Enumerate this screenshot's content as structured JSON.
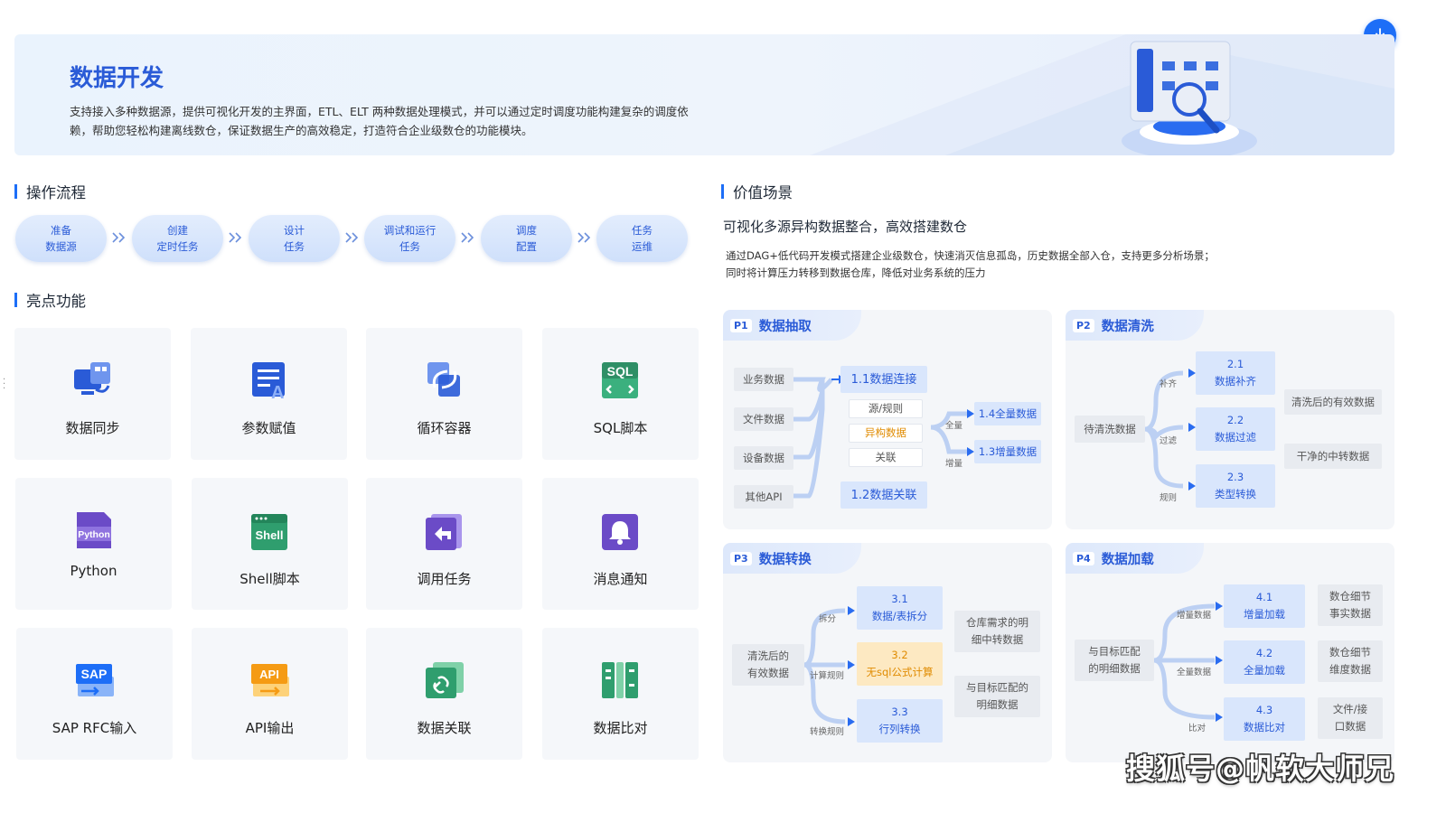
{
  "banner": {
    "title": "数据开发",
    "description": "支持接入多种数据源，提供可视化开发的主界面，ETL、ELT 两种数据处理模式，并可以通过定时调度功能构建复杂的调度依赖，帮助您轻松构建离线数仓，保证数据生产的高效稳定，打造符合企业级数仓的功能模块。"
  },
  "download_icon": "download-icon",
  "process": {
    "heading": "操作流程",
    "steps": [
      "准备\n数据源",
      "创建\n定时任务",
      "设计\n任务",
      "调试和运行\n任务",
      "调度\n配置",
      "任务\n运维"
    ]
  },
  "features": {
    "heading": "亮点功能",
    "items": [
      {
        "label": "数据同步",
        "icon": "data-sync-icon"
      },
      {
        "label": "参数赋值",
        "icon": "parameter-icon"
      },
      {
        "label": "循环容器",
        "icon": "loop-icon"
      },
      {
        "label": "SQL脚本",
        "icon": "sql-icon",
        "icon_text": "SQL"
      },
      {
        "label": "Python",
        "icon": "python-icon",
        "icon_text": "Python"
      },
      {
        "label": "Shell脚本",
        "icon": "shell-icon",
        "icon_text": "Shell"
      },
      {
        "label": "调用任务",
        "icon": "call-task-icon"
      },
      {
        "label": "消息通知",
        "icon": "bell-icon"
      },
      {
        "label": "SAP RFC输入",
        "icon": "sap-icon",
        "icon_text": "SAP"
      },
      {
        "label": "API输出",
        "icon": "api-icon",
        "icon_text": "API"
      },
      {
        "label": "数据关联",
        "icon": "link-icon"
      },
      {
        "label": "数据比对",
        "icon": "compare-icon"
      }
    ]
  },
  "value": {
    "heading": "价值场景",
    "title": "可视化多源异构数据整合，高效搭建数仓",
    "desc_line1": "通过DAG+低代码开发模式搭建企业级数仓，快速消灭信息孤岛，历史数据全部入仓，支持更多分析场景；",
    "desc_line2": "同时将计算压力转移到数据仓库，降低对业务系统的压力"
  },
  "panels": {
    "p1": {
      "badge": "P1",
      "title": "数据抽取",
      "sources": [
        "业务数据",
        "文件数据",
        "设备数据",
        "其他API"
      ],
      "connect": "1.1数据连接",
      "rules": [
        "源/规则",
        "异构数据",
        "关联"
      ],
      "relate": "1.2数据关联",
      "label_full": "全量",
      "label_inc": "增量",
      "full": "1.4全量数据",
      "inc": "1.3增量数据"
    },
    "p2": {
      "badge": "P2",
      "title": "数据清洗",
      "source": "待清洗数据",
      "labels": [
        "补齐",
        "过滤",
        "规则"
      ],
      "steps": [
        "2.1\n数据补齐",
        "2.2\n数据过滤",
        "2.3\n类型转换"
      ],
      "outputs": [
        "清洗后的有效数据",
        "干净的中转数据"
      ]
    },
    "p3": {
      "badge": "P3",
      "title": "数据转换",
      "source": "清洗后的\n有效数据",
      "labels": [
        "拆分",
        "计算规则",
        "转换规则"
      ],
      "steps": [
        "3.1\n数据/表拆分",
        "3.2\n无sql公式计算",
        "3.3\n行列转换"
      ],
      "outputs": [
        "仓库需求的明\n细中转数据",
        "与目标匹配的\n明细数据"
      ]
    },
    "p4": {
      "badge": "P4",
      "title": "数据加载",
      "source": "与目标匹配\n的明细数据",
      "labels": [
        "增量数据",
        "全量数据",
        "比对"
      ],
      "steps": [
        "4.1\n增量加载",
        "4.2\n全量加载",
        "4.3\n数据比对"
      ],
      "outputs": [
        "数仓细节\n事实数据",
        "数仓细节\n维度数据",
        "文件/接\n口数据"
      ]
    }
  },
  "watermark": "搜狐号@帆软大师兄"
}
